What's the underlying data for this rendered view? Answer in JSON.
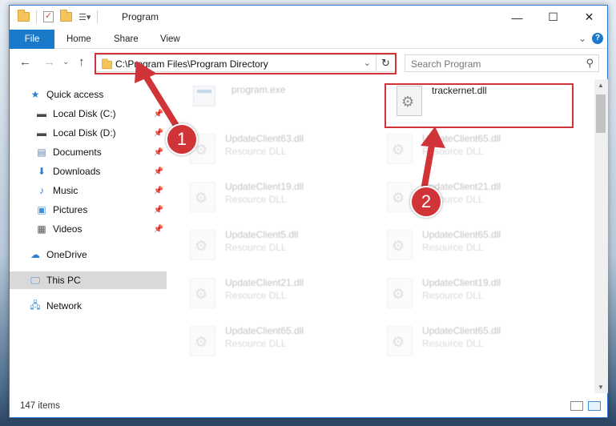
{
  "window": {
    "title": "Program",
    "minimize_icon": "minimize-icon",
    "maximize_icon": "maximize-icon",
    "close_icon": "close-icon"
  },
  "ribbon": {
    "tabs": [
      "File",
      "Home",
      "Share",
      "View"
    ]
  },
  "navigation": {
    "address_path": "C:\\Program Files\\Program Directory",
    "search_placeholder": "Search Program"
  },
  "sidebar": {
    "items": [
      {
        "label": "Quick access",
        "icon": "star-icon"
      },
      {
        "label": "Local Disk (C:)",
        "icon": "drive-icon"
      },
      {
        "label": "Local Disk (D:)",
        "icon": "drive-icon"
      },
      {
        "label": "Documents",
        "icon": "documents-icon"
      },
      {
        "label": "Downloads",
        "icon": "download-icon"
      },
      {
        "label": "Music",
        "icon": "music-icon"
      },
      {
        "label": "Pictures",
        "icon": "pictures-icon"
      },
      {
        "label": "Videos",
        "icon": "videos-icon"
      },
      {
        "label": "OneDrive",
        "icon": "cloud-icon"
      },
      {
        "label": "This PC",
        "icon": "computer-icon"
      },
      {
        "label": "Network",
        "icon": "network-icon"
      }
    ]
  },
  "files": {
    "featured": {
      "name": "program.exe"
    },
    "target": {
      "name": "trackernet.dll"
    },
    "rows": [
      [
        {
          "name": "UpdateClient63.dll",
          "type": "Resource DLL"
        },
        {
          "name": "UpdateClient65.dll",
          "type": "Resource DLL"
        }
      ],
      [
        {
          "name": "UpdateClient19.dll",
          "type": "Resource DLL"
        },
        {
          "name": "UpdateClient21.dll",
          "type": "Resource DLL"
        }
      ],
      [
        {
          "name": "UpdateClient5.dll",
          "type": "Resource DLL"
        },
        {
          "name": "UpdateClient65.dll",
          "type": "Resource DLL"
        }
      ],
      [
        {
          "name": "UpdateClient21.dll",
          "type": "Resource DLL"
        },
        {
          "name": "UpdateClient19.dll",
          "type": "Resource DLL"
        }
      ],
      [
        {
          "name": "UpdateClient65.dll",
          "type": "Resource DLL"
        },
        {
          "name": "UpdateClient65.dll",
          "type": "Resource DLL"
        }
      ]
    ]
  },
  "status": {
    "item_count": "147 items"
  },
  "annotations": {
    "step1": "1",
    "step2": "2",
    "color": "#d13438"
  },
  "colors": {
    "accent": "#1979ca",
    "highlight": "#d13438"
  }
}
